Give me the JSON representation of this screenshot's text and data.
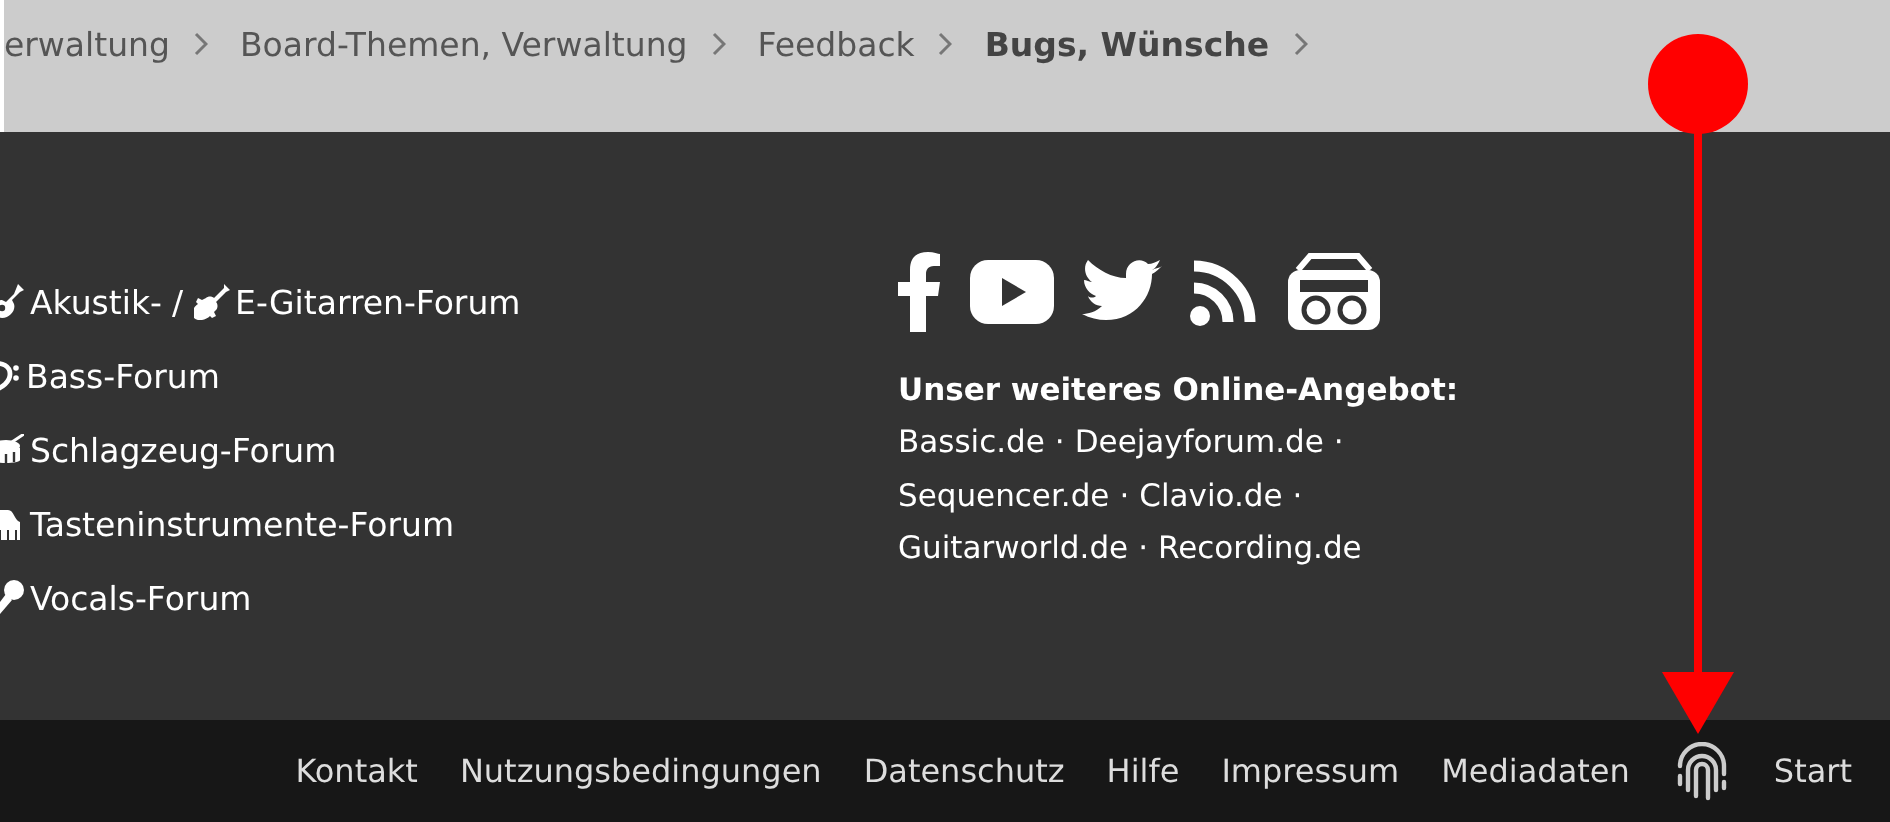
{
  "breadcrumb": [
    {
      "label": "erwaltung",
      "current": false
    },
    {
      "label": "Board-Themen, Verwaltung",
      "current": false
    },
    {
      "label": "Feedback",
      "current": false
    },
    {
      "label": "Bugs, Wünsche",
      "current": true
    }
  ],
  "forums": [
    {
      "links": [
        {
          "label": "Akustik-"
        },
        {
          "label": "E-Gitarren-Forum"
        }
      ],
      "separator": "/"
    },
    {
      "links": [
        {
          "label": "Bass-Forum"
        }
      ]
    },
    {
      "links": [
        {
          "label": "Schlagzeug-Forum"
        }
      ]
    },
    {
      "links": [
        {
          "label": "Tasteninstrumente-Forum"
        }
      ]
    },
    {
      "links": [
        {
          "label": "Vocals-Forum"
        }
      ]
    }
  ],
  "offer": {
    "heading": "Unser weiteres Online-Angebot:",
    "lines": [
      [
        {
          "label": "Bassic.de",
          "sep": "·"
        },
        {
          "label": "Deejayforum.de",
          "sep": "·"
        }
      ],
      [
        {
          "label": "Sequencer.de",
          "sep": "·"
        },
        {
          "label": "Clavio.de",
          "sep": "·"
        }
      ],
      [
        {
          "label": "Guitarworld.de",
          "sep": "·"
        },
        {
          "label": "Recording.de"
        }
      ]
    ]
  },
  "bottom_links": [
    {
      "kind": "text",
      "label": "Kontakt"
    },
    {
      "kind": "text",
      "label": "Nutzungsbedingungen"
    },
    {
      "kind": "text",
      "label": "Datenschutz"
    },
    {
      "kind": "text",
      "label": "Hilfe"
    },
    {
      "kind": "text",
      "label": "Impressum"
    },
    {
      "kind": "text",
      "label": "Mediadaten"
    },
    {
      "kind": "fingerprint"
    },
    {
      "kind": "text",
      "label": "Start"
    }
  ]
}
